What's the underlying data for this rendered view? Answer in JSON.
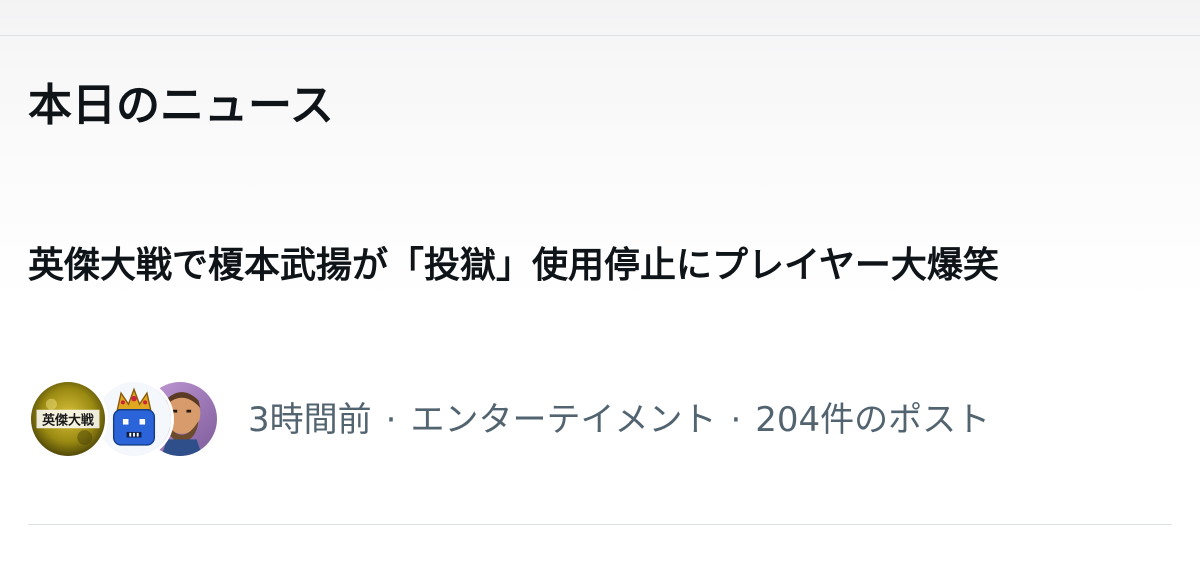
{
  "section": {
    "title": "本日のニュース"
  },
  "news_item": {
    "headline": "英傑大戦で榎本武揚が「投獄」使用停止にプレイヤー大爆笑",
    "time": "3時間前",
    "separator": "·",
    "category": "エンターテイメント",
    "post_count": "204件のポスト",
    "avatars": [
      {
        "name": "eiketsu-taisen-logo-avatar",
        "text": "英傑大戦"
      },
      {
        "name": "crowned-character-avatar"
      },
      {
        "name": "bearded-man-avatar"
      }
    ]
  },
  "colors": {
    "title_text": "#0f1419",
    "meta_text": "#536471",
    "divider": "#dcdfe3",
    "background": "#ffffff"
  }
}
